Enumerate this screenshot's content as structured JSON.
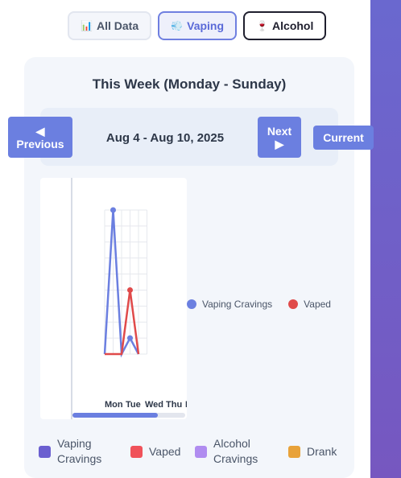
{
  "tabs": [
    {
      "label": "All Data",
      "icon": "bar-chart-icon",
      "active": false
    },
    {
      "label": "Vaping",
      "icon": "vape-icon",
      "active": true
    },
    {
      "label": "Alcohol",
      "icon": "wine-glass-icon",
      "active": false
    }
  ],
  "week_title": "This Week (Monday - Sunday)",
  "nav": {
    "previous_arrow": "◀",
    "previous_label": "Previous",
    "next_label": "Next",
    "next_arrow": "▶",
    "current_label": "Current",
    "date_range": "Aug 4 - Aug 10, 2025"
  },
  "chart_data": {
    "type": "line",
    "categories": [
      "Mon",
      "Tue",
      "Wed",
      "Thu",
      "Fri"
    ],
    "series": [
      {
        "name": "Vaping Cravings",
        "color": "#6b7fe0",
        "values": [
          0,
          9,
          0,
          1,
          0
        ]
      },
      {
        "name": "Vaped",
        "color": "#e04a4a",
        "values": [
          0,
          0,
          0,
          4,
          0
        ]
      }
    ],
    "ylim": [
      0,
      9
    ],
    "grid": true,
    "legend": "right"
  },
  "bottom_legend": [
    {
      "label": "Vaping Cravings",
      "color": "#6b5fd0"
    },
    {
      "label": "Vaped",
      "color": "#f0525a"
    },
    {
      "label": "Alcohol Cravings",
      "color": "#b08cf0"
    },
    {
      "label": "Drank",
      "color": "#e8a23a"
    }
  ]
}
